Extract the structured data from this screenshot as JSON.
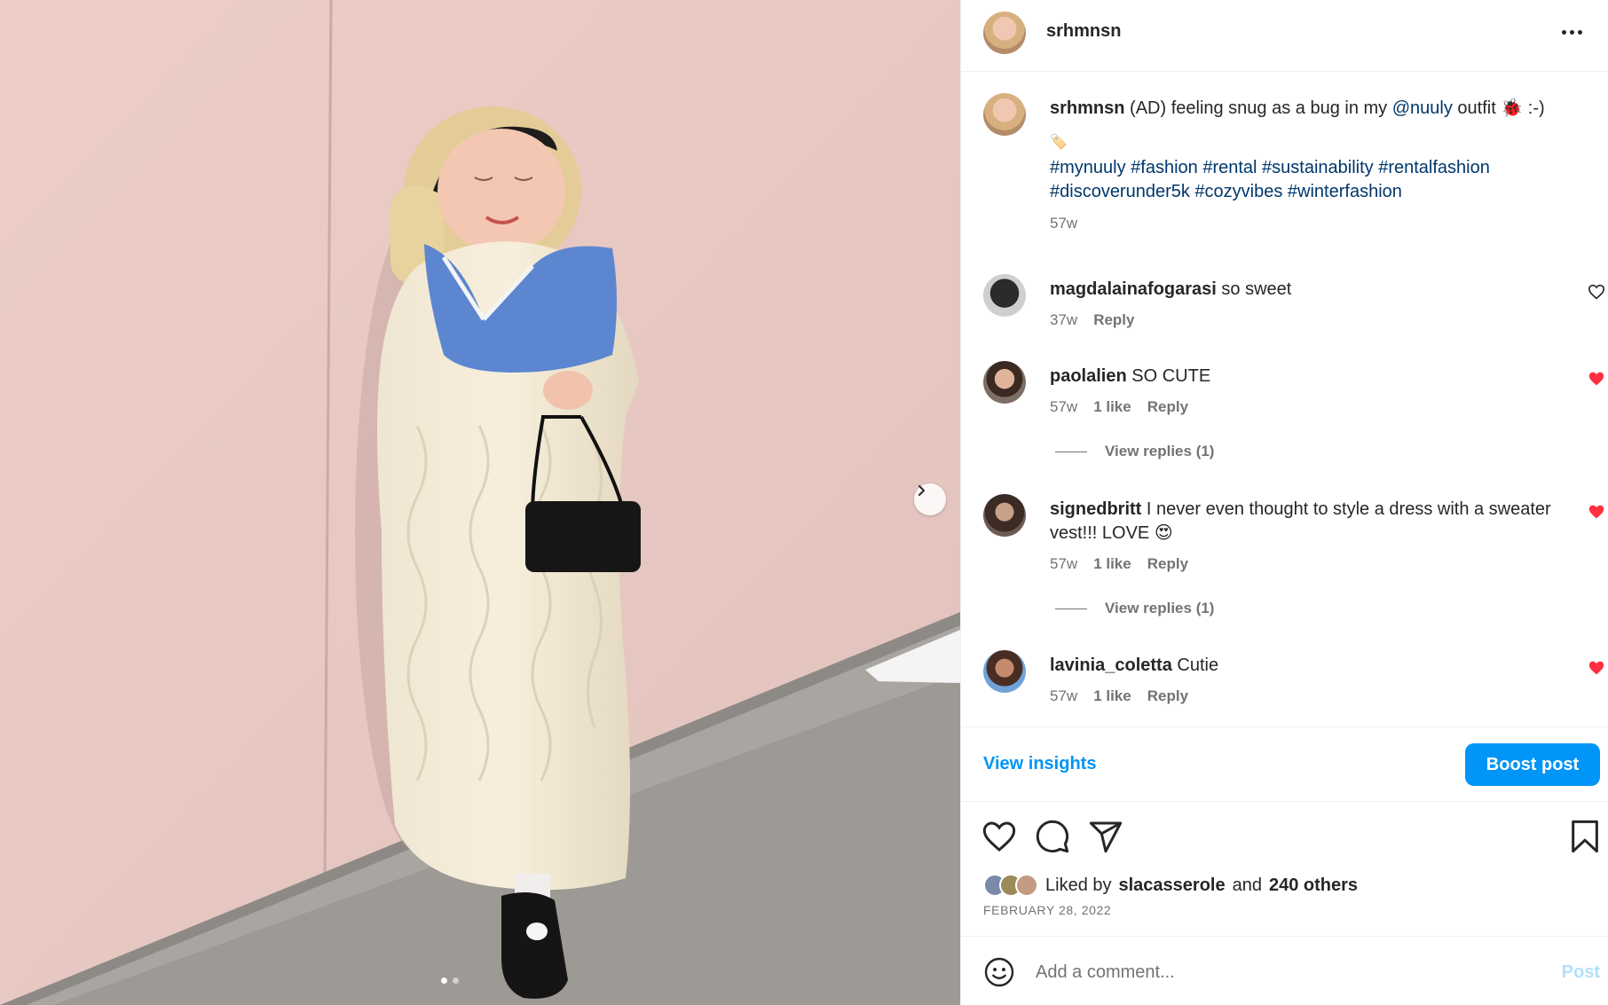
{
  "post": {
    "username": "srhmnsn",
    "caption": {
      "username": "srhmnsn",
      "text_before": "(AD) feeling snug as a bug in my ",
      "mention": "@nuuly",
      "text_after": " outfit 🐞 :-)",
      "label_emoji": "🏷️",
      "hashtags_line1": "#mynuuly #fashion #rental #sustainability #rentalfashion",
      "hashtags_line2": "#discoverunder5k #cozyvibes #winterfashion",
      "time": "57w"
    }
  },
  "comments": [
    {
      "username": "magdalainafogarasi",
      "text": "so sweet",
      "time": "37w",
      "likes": "",
      "reply": "Reply",
      "liked": false
    },
    {
      "username": "paolalien",
      "text": "SO CUTE",
      "time": "57w",
      "likes": "1 like",
      "reply": "Reply",
      "liked": true,
      "view_replies": "View replies (1)"
    },
    {
      "username": "signedbritt",
      "text": "I never even thought to style a dress with a sweater vest!!! LOVE 😍",
      "time": "57w",
      "likes": "1 like",
      "reply": "Reply",
      "liked": true,
      "view_replies": "View replies (1)"
    },
    {
      "username": "lavinia_coletta",
      "text": "Cutie",
      "time": "57w",
      "likes": "1 like",
      "reply": "Reply",
      "liked": true
    }
  ],
  "insights": {
    "view_label": "View insights",
    "boost_label": "Boost post"
  },
  "likes": {
    "prefix": "Liked by",
    "user": "slacasserole",
    "and": "and",
    "others": "240 others"
  },
  "date": "FEBRUARY 28, 2022",
  "add_comment": {
    "placeholder": "Add a comment...",
    "post_label": "Post"
  },
  "carousel": {
    "total": 2,
    "current": 1
  },
  "colors": {
    "accent": "#0095f6",
    "like_red": "#ff3040",
    "link": "#00376b",
    "muted": "#737373"
  },
  "icons": [
    "more-icon",
    "chevron-right-icon",
    "heart-icon",
    "comment-icon",
    "share-icon",
    "bookmark-icon",
    "emoji-icon"
  ]
}
